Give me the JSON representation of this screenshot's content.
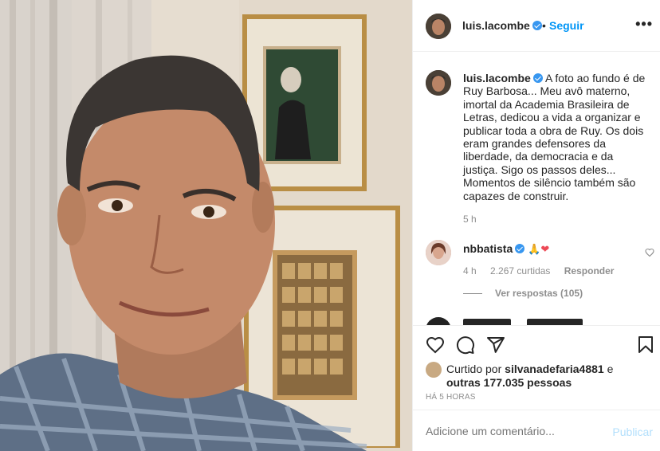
{
  "post": {
    "photo_alt": "",
    "header": {
      "username": "luis.lacombe",
      "separator": "•",
      "follow_label": "Seguir",
      "more_label": "•••"
    },
    "caption": {
      "username": "luis.lacombe",
      "text": "A foto ao fundo é de Ruy Barbosa... Meu avô materno, imortal da Academia Brasileira de Letras, dedicou a vida a organizar e publicar toda a obra de Ruy. Os dois eram grandes defensores da liberdade, da democracia e da justiça. Sigo os passos deles... Momentos de silêncio também são capazes de construir.",
      "time": "5 h"
    },
    "comments": [
      {
        "username": "nbbatista",
        "emoji_pray": "🙏",
        "emoji_heart": "❤",
        "time": "4 h",
        "likes": "2.267 curtidas",
        "reply_label": "Responder",
        "view_replies": "Ver respostas (105)"
      }
    ],
    "likes": {
      "prefix": "Curtido por",
      "user": "silvanadefaria4881",
      "conj": "e",
      "others": "outras 177.035 pessoas"
    },
    "posted_ago": "HÁ 5 HORAS",
    "comment_box": {
      "placeholder": "Adicione um comentário...",
      "publish_label": "Publicar"
    },
    "colors": {
      "link_blue": "#0095f6",
      "verified_blue": "#3897f0",
      "heart_red": "#ed4956",
      "muted": "#8e8e8e",
      "publish_disabled": "#b2dffc"
    },
    "icons": [
      "heart-icon",
      "comment-icon",
      "share-icon",
      "bookmark-icon",
      "verified-icon",
      "more-icon"
    ]
  }
}
